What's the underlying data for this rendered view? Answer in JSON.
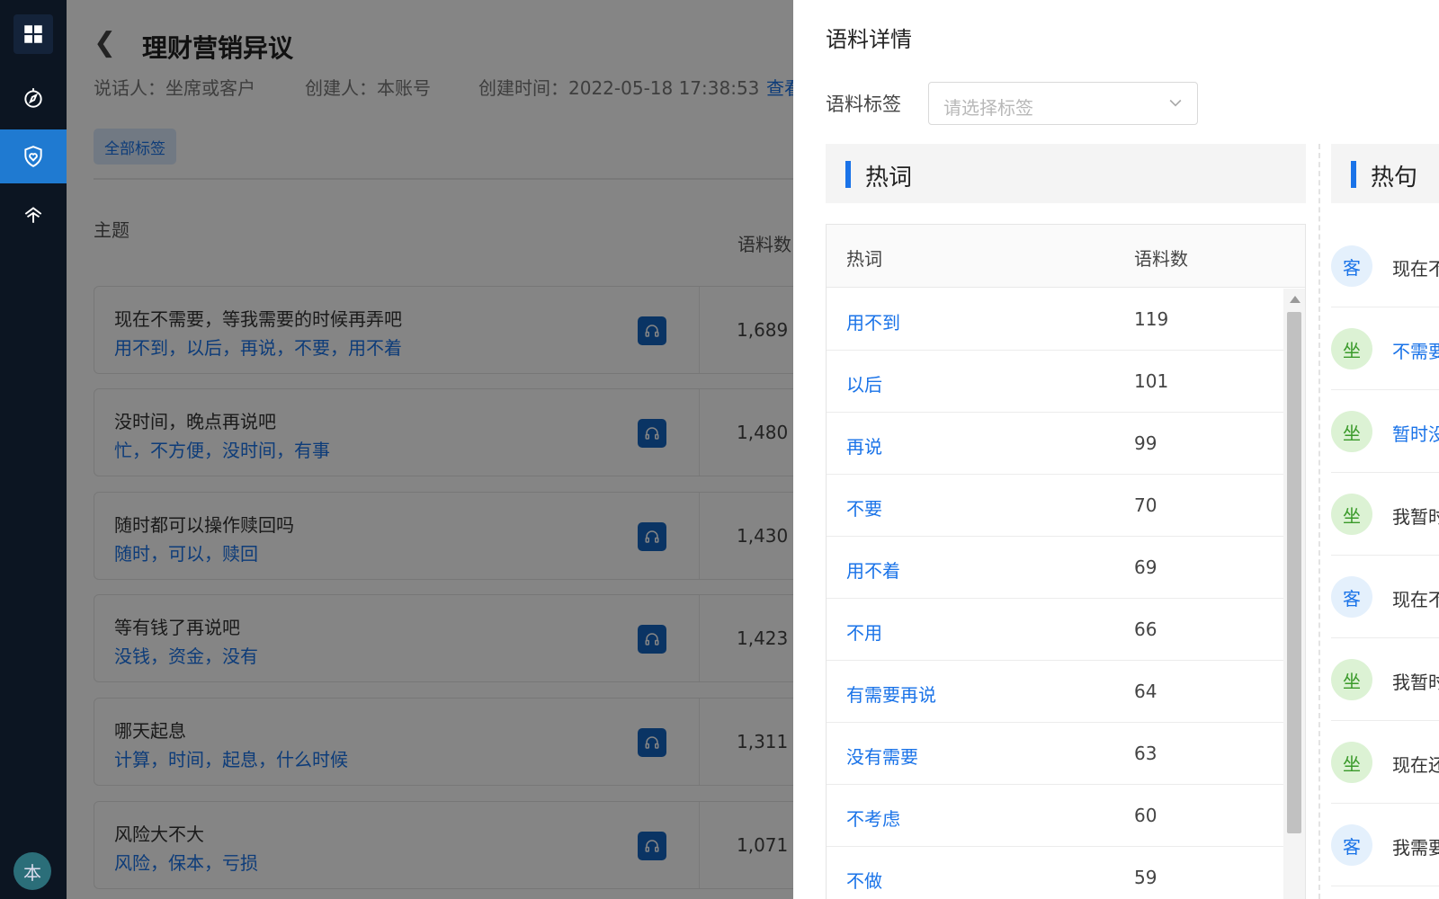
{
  "header": {
    "title": "理财营销异议",
    "speaker": "说话人：坐席或客户",
    "creator": "创建人：本账号",
    "created_time": "创建时间：2022-05-18 17:38:53",
    "view_link": "查看"
  },
  "filters": {
    "all_tags": "全部标签"
  },
  "topic_table": {
    "col_topic": "主题",
    "col_count": "语料数",
    "rows": [
      {
        "title": "现在不需要，等我需要的时候再弄吧",
        "keywords": "用不到，以后，再说，不要，用不着",
        "count": "1,689"
      },
      {
        "title": "没时间，晚点再说吧",
        "keywords": "忙，不方便，没时间，有事",
        "count": "1,480"
      },
      {
        "title": "随时都可以操作赎回吗",
        "keywords": "随时，可以，赎回",
        "count": "1,430"
      },
      {
        "title": "等有钱了再说吧",
        "keywords": "没钱，资金，没有",
        "count": "1,423"
      },
      {
        "title": "哪天起息",
        "keywords": "计算，时间，起息，什么时候",
        "count": "1,311"
      },
      {
        "title": "风险大不大",
        "keywords": "风险，保本，亏损",
        "count": "1,071"
      }
    ]
  },
  "drawer": {
    "title": "语料详情",
    "label_field": "语料标签",
    "select_placeholder": "请选择标签",
    "hotwords": {
      "section_title": "热词",
      "col_word": "热词",
      "col_count": "语料数",
      "rows": [
        {
          "word": "用不到",
          "count": "119"
        },
        {
          "word": "以后",
          "count": "101"
        },
        {
          "word": "再说",
          "count": "99"
        },
        {
          "word": "不要",
          "count": "70"
        },
        {
          "word": "用不着",
          "count": "69"
        },
        {
          "word": "不用",
          "count": "66"
        },
        {
          "word": "有需要再说",
          "count": "64"
        },
        {
          "word": "没有需要",
          "count": "63"
        },
        {
          "word": "不考虑",
          "count": "60"
        },
        {
          "word": "不做",
          "count": "59"
        }
      ]
    },
    "hot_sentences": {
      "section_title": "热句",
      "rows": [
        {
          "speaker": "客",
          "text": "现在不",
          "style": "dark"
        },
        {
          "speaker": "坐",
          "text": "不需要",
          "style": "blue"
        },
        {
          "speaker": "坐",
          "text": "暂时没",
          "style": "blue"
        },
        {
          "speaker": "坐",
          "text": "我暂时",
          "style": "dark"
        },
        {
          "speaker": "客",
          "text": "现在不",
          "style": "dark"
        },
        {
          "speaker": "坐",
          "text": "我暂时",
          "style": "dark"
        },
        {
          "speaker": "坐",
          "text": "现在还",
          "style": "dark"
        },
        {
          "speaker": "客",
          "text": "我需要",
          "style": "dark"
        }
      ]
    }
  },
  "user": {
    "avatar_text": "本"
  },
  "colors": {
    "accent": "#1a73e8",
    "sidebar": "#0c1522",
    "sidebar_active": "#1f7ad1"
  }
}
